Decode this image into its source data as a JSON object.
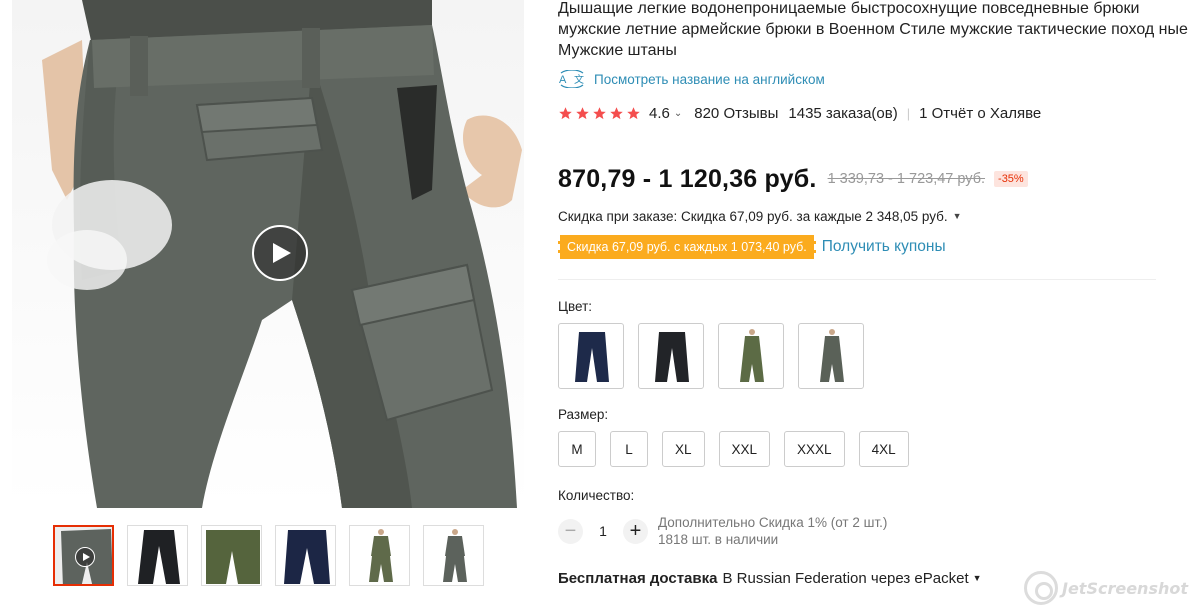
{
  "product": {
    "title": "Дышащие легкие водонепроницаемые быстросохнущие повседневные брюки мужские летние армейские брюки в Военном Стиле мужские тактические поход ные Мужские штаны",
    "translate_link": "Посмотреть название на английском",
    "translate_icon": "translate-icon",
    "rating": {
      "value": "4.6",
      "stars": 5,
      "reviews": "820 Отзывы",
      "orders": "1435 заказа(ов)",
      "free_report": "1 Отчёт о Халяве"
    }
  },
  "pricing": {
    "current": "870,79 - 1 120,36 руб.",
    "original": "1 339,73 - 1 723,47 руб.",
    "discount_badge": "-35%",
    "order_discount": "Скидка при заказе: Скидка 67,09 руб. за каждые 2 348,05 руб.",
    "coupon_tag": "Скидка 67,09 руб. с каждых 1 073,40 руб.",
    "get_coupons": "Получить купоны",
    "colors": {
      "accent": "#e62e04",
      "star": "#f44e4e",
      "coupon": "#fbab1e",
      "link": "#2e8db5"
    }
  },
  "options": {
    "color_label": "Цвет:",
    "colors": [
      {
        "name": "navy",
        "hex": "#1e2a4a"
      },
      {
        "name": "black",
        "hex": "#222428"
      },
      {
        "name": "army-green",
        "hex": "#5c6b45"
      },
      {
        "name": "gray",
        "hex": "#5a6158"
      }
    ],
    "size_label": "Размер:",
    "sizes": [
      "M",
      "L",
      "XL",
      "XXL",
      "XXXL",
      "4XL"
    ]
  },
  "quantity": {
    "label": "Количество:",
    "minus": "−",
    "plus": "+",
    "value": "1",
    "extra_discount": "Дополнительно Скидка 1% (от 2 шт.)",
    "stock": "1818 шт. в наличии"
  },
  "shipping": {
    "label": "Бесплатная доставка",
    "detail": "В Russian Federation через ePacket"
  },
  "gallery": {
    "play_icon": "play-icon",
    "thumbnails": [
      {
        "name": "gray-video",
        "hex": "#5d635e",
        "video": true
      },
      {
        "name": "black",
        "hex": "#1f2124",
        "video": false
      },
      {
        "name": "green",
        "hex": "#55643d",
        "video": false
      },
      {
        "name": "navy",
        "hex": "#1c2645",
        "video": false
      },
      {
        "name": "army-green",
        "hex": "#5f6a4a",
        "video": false
      },
      {
        "name": "gray",
        "hex": "#5c625c",
        "video": false
      }
    ]
  },
  "watermark": "JetScreenshot"
}
